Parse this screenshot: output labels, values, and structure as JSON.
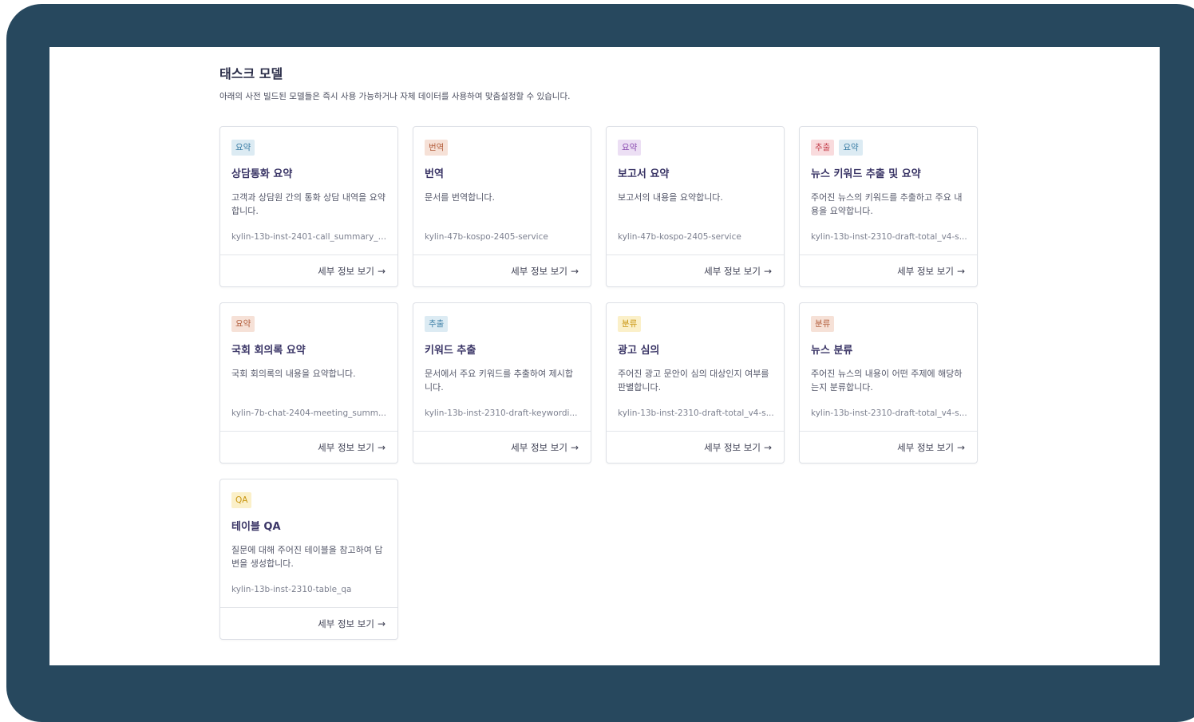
{
  "section": {
    "title": "태스크 모델",
    "subtitle": "아래의 사전 빌드된 모델들은 즉시 사용 가능하거나 자체 데이터를 사용하여 맞춤설정할 수 있습니다."
  },
  "cards": [
    {
      "tags": [
        {
          "label": "요약",
          "color": "#3d7fa6"
        }
      ],
      "title": "상담통화 요약",
      "description": "고객과 상담원 간의 통화 상담 내역을 요약합니다.",
      "model": "kylin-13b-inst-2401-call_summary_v...",
      "link": "세부 정보 보기"
    },
    {
      "tags": [
        {
          "label": "번역",
          "color": "#b4603f"
        }
      ],
      "title": "번역",
      "description": "문서를 번역합니다.",
      "model": "kylin-47b-kospo-2405-service",
      "link": "세부 정보 보기"
    },
    {
      "tags": [
        {
          "label": "요약",
          "color": "#8a4cb0"
        }
      ],
      "title": "보고서 요약",
      "description": "보고서의 내용을 요약합니다.",
      "model": "kylin-47b-kospo-2405-service",
      "link": "세부 정보 보기"
    },
    {
      "tags": [
        {
          "label": "추출",
          "color": "#c23b48"
        },
        {
          "label": "요약",
          "color": "#3d7fa6"
        }
      ],
      "title": "뉴스 키워드 추출 및 요약",
      "description": "주어진 뉴스의 키워드를 추출하고 주요 내용을 요약합니다.",
      "model": "kylin-13b-inst-2310-draft-total_v4-s...",
      "link": "세부 정보 보기"
    },
    {
      "tags": [
        {
          "label": "요약",
          "color": "#b4603f"
        }
      ],
      "title": "국회 회의록 요약",
      "description": "국회 회의록의 내용을 요약합니다.",
      "model": "kylin-7b-chat-2404-meeting_summ...",
      "link": "세부 정보 보기"
    },
    {
      "tags": [
        {
          "label": "추출",
          "color": "#3d7fa6"
        }
      ],
      "title": "키워드 추출",
      "description": "문서에서 주요 키워드를 추출하여 제시합니다.",
      "model": "kylin-13b-inst-2310-draft-keywordi...",
      "link": "세부 정보 보기"
    },
    {
      "tags": [
        {
          "label": "분류",
          "color": "#c9950f"
        }
      ],
      "title": "광고 심의",
      "description": "주어진 광고 문안이 심의 대상인지 여부를 판별합니다.",
      "model": "kylin-13b-inst-2310-draft-total_v4-s...",
      "link": "세부 정보 보기"
    },
    {
      "tags": [
        {
          "label": "분류",
          "color": "#b4603f"
        }
      ],
      "title": "뉴스 분류",
      "description": "주어진 뉴스의 내용이 어떤 주제에 해당하는지 분류합니다.",
      "model": "kylin-13b-inst-2310-draft-total_v4-s...",
      "link": "세부 정보 보기"
    },
    {
      "tags": [
        {
          "label": "QA",
          "color": "#c9950f"
        }
      ],
      "title": "테이블 QA",
      "description": "질문에 대해 주어진 테이블을 참고하여 답변을 생성합니다.",
      "model": "kylin-13b-inst-2310-table_qa",
      "link": "세부 정보 보기"
    }
  ]
}
